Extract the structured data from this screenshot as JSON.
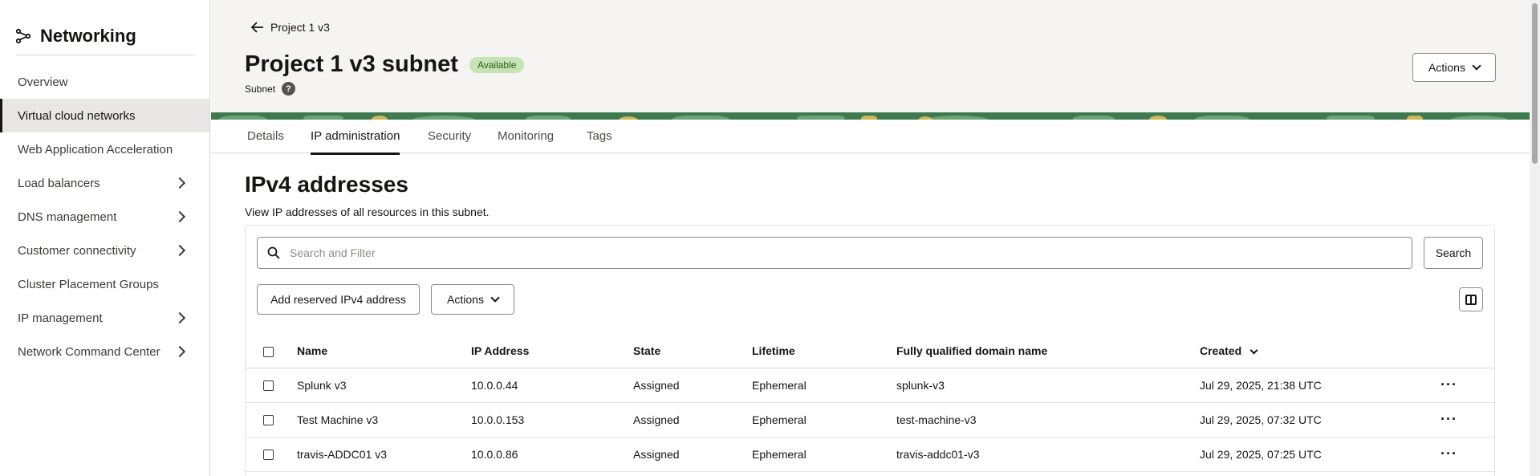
{
  "app": {
    "title": "Networking",
    "icon": "network-icon"
  },
  "sidebar": {
    "items": [
      {
        "label": "Overview",
        "has_children": false
      },
      {
        "label": "Virtual cloud networks",
        "has_children": false,
        "active": true
      },
      {
        "label": "Web Application Acceleration",
        "has_children": false
      },
      {
        "label": "Load balancers",
        "has_children": true
      },
      {
        "label": "DNS management",
        "has_children": true
      },
      {
        "label": "Customer connectivity",
        "has_children": true
      },
      {
        "label": "Cluster Placement Groups",
        "has_children": false
      },
      {
        "label": "IP management",
        "has_children": true
      },
      {
        "label": "Network Command Center",
        "has_children": true
      }
    ]
  },
  "header": {
    "back_label": "Project 1 v3",
    "title": "Project 1 v3 subnet",
    "status_badge": "Available",
    "subtitle": "Subnet",
    "help_icon": "?",
    "actions_label": "Actions"
  },
  "tabs": [
    {
      "label": "Details"
    },
    {
      "label": "IP administration",
      "active": true
    },
    {
      "label": "Security"
    },
    {
      "label": "Monitoring"
    },
    {
      "label": "Tags"
    }
  ],
  "section": {
    "title": "IPv4 addresses",
    "description": "View IP addresses of all resources in this subnet."
  },
  "toolbar": {
    "search_placeholder": "Search and Filter",
    "search_button": "Search",
    "add_button": "Add reserved IPv4 address",
    "actions_button": "Actions"
  },
  "table": {
    "columns": [
      "Name",
      "IP Address",
      "State",
      "Lifetime",
      "Fully qualified domain name",
      "Created"
    ],
    "sorted_column": "Created",
    "rows": [
      {
        "name": "Splunk v3",
        "ip": "10.0.0.44",
        "state": "Assigned",
        "lifetime": "Ephemeral",
        "fqdn": "splunk-v3",
        "created": "Jul 29, 2025, 21:38 UTC"
      },
      {
        "name": "Test Machine v3",
        "ip": "10.0.0.153",
        "state": "Assigned",
        "lifetime": "Ephemeral",
        "fqdn": "test-machine-v3",
        "created": "Jul 29, 2025, 07:32 UTC"
      },
      {
        "name": "travis-ADDC01 v3",
        "ip": "10.0.0.86",
        "state": "Assigned",
        "lifetime": "Ephemeral",
        "fqdn": "travis-addc01-v3",
        "created": "Jul 29, 2025, 07:25 UTC"
      }
    ],
    "row_menu_glyph": "···"
  },
  "colors": {
    "badge_bg": "#c6e3b4",
    "header_bg": "#f5f4f2",
    "active_nav_bg": "#e8e7e5",
    "banner_green": "#3f7a4f"
  }
}
